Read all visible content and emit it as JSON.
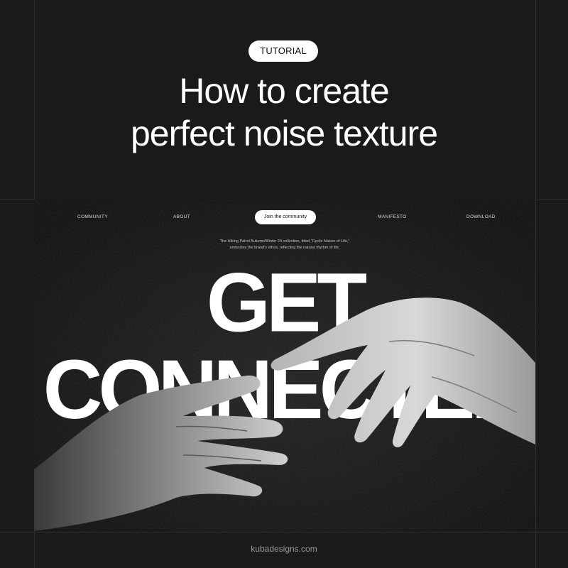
{
  "header": {
    "tag_label": "TUTORIAL",
    "title_line_1": "How to create",
    "title_line_2": "perfect noise texture"
  },
  "mockup": {
    "nav": {
      "community": "COMMUNITY",
      "about": "ABOUT",
      "join_button": "Join the community",
      "manifesto": "MANIFESTO",
      "download": "DOWNLOAD"
    },
    "intro_line_1": "The Hiking Patrol Autumn/Winter 24 collection, titled \"Cyclic Nature of Life,\"",
    "intro_line_2": "embodies the brand's ethos, reflecting the natural rhythm of life.",
    "headline": "GET CONNECTED",
    "image": "reaching-hands-photo"
  },
  "footer": {
    "credit": "kubadesigns.com"
  },
  "colors": {
    "background": "#1a1a1a",
    "mockup_background": "#0f0f0f",
    "accent": "#ffffff",
    "guide_lines": "#2e2e2e"
  }
}
